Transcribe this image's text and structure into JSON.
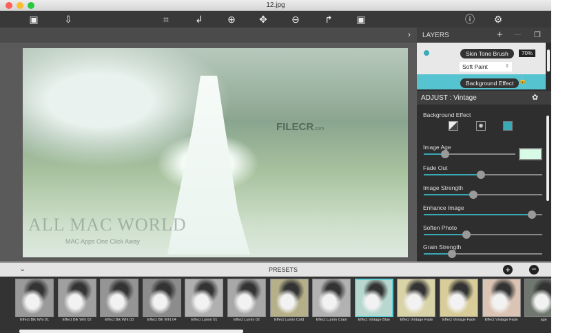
{
  "window": {
    "title": "12.jpg"
  },
  "toolbar": {
    "icons": [
      "image-icon",
      "import-icon",
      "crop-icon",
      "rotate-left-icon",
      "zoom-in-icon",
      "move-icon",
      "zoom-out-icon",
      "rotate-right-icon",
      "export-icon",
      "info-icon",
      "settings-icon"
    ]
  },
  "watermarks": {
    "brand1": "ALL MAC WORLD",
    "tagline": "MAC Apps One Click Away",
    "brand2": "FILECR",
    "brand2_sub": ".com"
  },
  "layers": {
    "title": "LAYERS",
    "add": "+",
    "remove": "—",
    "items": [
      {
        "name": "Skin Tone Brush",
        "opacity": "70%",
        "mode": "Soft Paint"
      },
      {
        "name": "Background Effect"
      }
    ]
  },
  "adjust": {
    "title": "ADJUST : Vintage",
    "section": "Background Effect",
    "image_age_color": "#d8fbe8",
    "sliders": [
      {
        "label": "Image Age",
        "value": 0.23
      },
      {
        "label": "Fade Out",
        "value": 0.48
      },
      {
        "label": "Image Strength",
        "value": 0.42
      },
      {
        "label": "Enhance Image",
        "value": 0.91
      },
      {
        "label": "Soften Photo",
        "value": 0.36
      },
      {
        "label": "Grain Strength",
        "value": 0.24
      }
    ]
  },
  "presets": {
    "title": "PRESETS",
    "items": [
      {
        "label": "Effect Blk Wht 01",
        "tone": "#9a9a9a"
      },
      {
        "label": "Effect Blk Wht 02",
        "tone": "#a0a0a0"
      },
      {
        "label": "Effect Blk Wht 03",
        "tone": "#959595"
      },
      {
        "label": "Effect Blk Wht 04",
        "tone": "#8c8c8c"
      },
      {
        "label": "Effect Lumin 01",
        "tone": "#b0b0b0"
      },
      {
        "label": "Effect Lumin 02",
        "tone": "#a8a8a8"
      },
      {
        "label": "Effect Lumin Cold",
        "tone": "#b5b08a"
      },
      {
        "label": "Effect Lumin Crain",
        "tone": "#b2b2b2"
      },
      {
        "label": "Effect Vintage Blue",
        "tone": "#b8d8cf",
        "selected": true
      },
      {
        "label": "Effect Vintage Fade",
        "tone": "#d9d3a8"
      },
      {
        "label": "Effect Vintage Fade",
        "tone": "#d8cc98"
      },
      {
        "label": "Effect Vintage Fade",
        "tone": "#dcc4b4"
      },
      {
        "label": "age",
        "tone": "#6f776f"
      }
    ]
  },
  "accent": "#3aa9b6"
}
